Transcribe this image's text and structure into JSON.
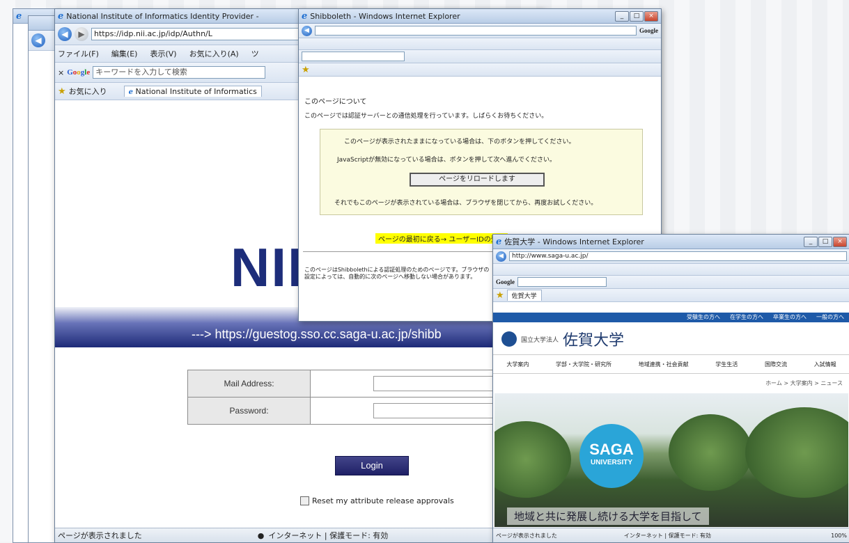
{
  "win_nii": {
    "title": "National Institute of Informatics Identity Provider -",
    "url": "https://idp.nii.ac.jp/idp/Authn/L",
    "menu": [
      "ファイル(F)",
      "編集(E)",
      "表示(V)",
      "お気に入り(A)",
      "ツ"
    ],
    "search_placeholder": "キーワードを入力して検索",
    "google": "Google",
    "favorites": "お気に入り",
    "tab_title": "National Institute of Informatics",
    "logo": "NII",
    "redirect_url": "---> https://guestog.sso.cc.saga-u.ac.jp/shibb",
    "mail_label": "Mail Address:",
    "password_label": "Password:",
    "login_button": "Login",
    "reset_checkbox": "Reset my attribute release approvals",
    "status_text": "ページが表示されました",
    "status_zone": "インターネット | 保護モード: 有効"
  },
  "win_notice": {
    "title": "Shibboleth - Windows Internet Explorer",
    "google_search": "Google",
    "line1": "このページについて",
    "line2": "このページでは認証サーバーとの通信処理を行っています。しばらくお待ちください。",
    "box1": "このページが表示されたままになっている場合は、下のボタンを押してください。",
    "box2": "JavaScriptが無効になっている場合は、ボタンを押して次へ進んでください。",
    "continue_button": "ページをリロードします",
    "box3": "それでもこのページが表示されている場合は、ブラウザを閉じてから、再度お試しください。",
    "highlight": "ページの最初に戻る→ ユーザーIDの登録",
    "footer": "このページはShibbolethによる認証処理のためのページです。ブラウザの設定によっては、自動的に次のページへ移動しない場合があります。"
  },
  "win_saga": {
    "title": "佐賀大学 - Windows Internet Explorer",
    "url": "http://www.saga-u.ac.jp/",
    "tab_title": "佐賀大学",
    "nav_top": [
      "受験生の方へ",
      "在学生の方へ",
      "卒業生の方へ",
      "一般の方へ"
    ],
    "univ_name": "佐賀大学",
    "univ_prefix": "国立大学法人",
    "nav_main": [
      "大学案内",
      "学部・大学院・研究所",
      "地域連携・社会貢献",
      "学生生活",
      "国際交流",
      "入試情報"
    ],
    "breadcrumb": "ホーム > 大学案内 > ニュース",
    "saga_top": "SAGA",
    "saga_bottom": "UNIVERSITY",
    "caption": "地域と共に発展し続ける大学を目指して",
    "status_left": "ページが表示されました",
    "status_zone": "インターネット | 保護モード: 有効",
    "zoom": "100%"
  }
}
